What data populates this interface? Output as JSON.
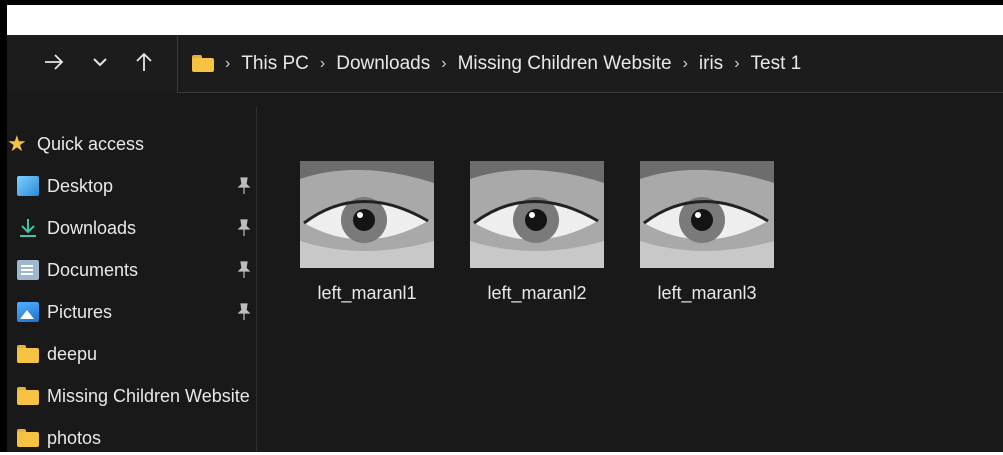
{
  "toolbar": {
    "forward_icon": "arrow-right-icon",
    "history_icon": "chevron-down-icon",
    "up_icon": "arrow-up-icon"
  },
  "address": {
    "crumbs": [
      "This PC",
      "Downloads",
      "Missing Children Website",
      "iris",
      "Test 1"
    ]
  },
  "sidebar": {
    "items": [
      {
        "label": "Quick access",
        "icon": "star-icon",
        "pinned": false
      },
      {
        "label": "Desktop",
        "icon": "desktop-icon",
        "pinned": true
      },
      {
        "label": "Downloads",
        "icon": "download-icon",
        "pinned": true
      },
      {
        "label": "Documents",
        "icon": "documents-icon",
        "pinned": true
      },
      {
        "label": "Pictures",
        "icon": "pictures-icon",
        "pinned": true
      },
      {
        "label": "deepu",
        "icon": "folder-icon",
        "pinned": false
      },
      {
        "label": "Missing Children Website",
        "icon": "folder-icon",
        "pinned": false
      },
      {
        "label": "photos",
        "icon": "folder-icon",
        "pinned": false
      }
    ]
  },
  "files": [
    {
      "name": "left_maranl1"
    },
    {
      "name": "left_maranl2"
    },
    {
      "name": "left_maranl3"
    }
  ]
}
